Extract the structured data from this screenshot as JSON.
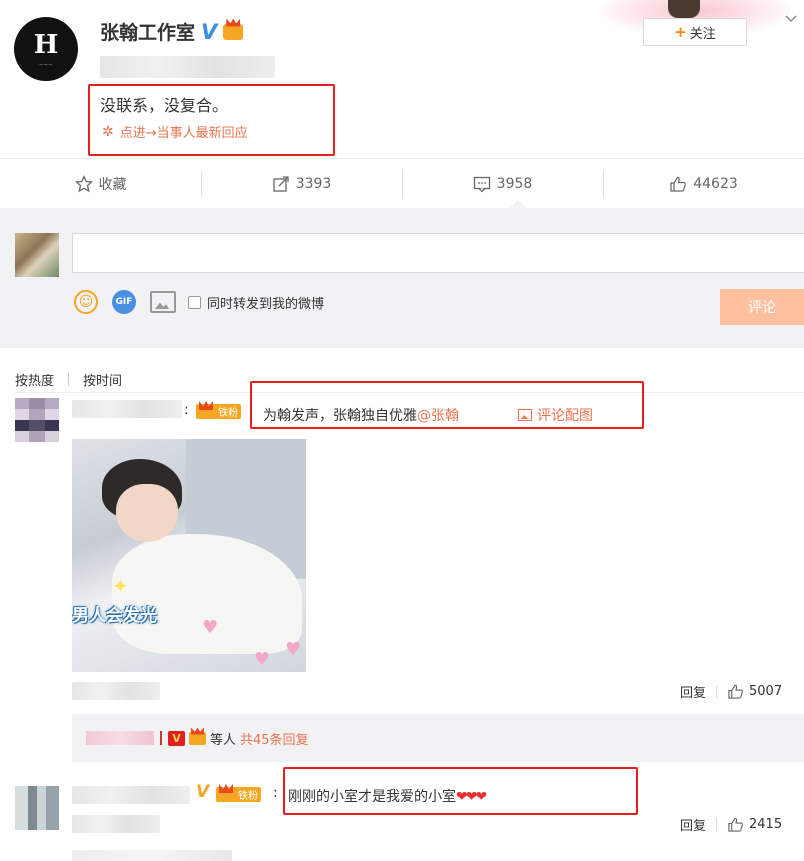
{
  "post": {
    "author": "张翰工作室",
    "text": "没联系，没复合。",
    "link_text": "点进→当事人最新回应",
    "follow_label": "关注"
  },
  "actions": {
    "favorite_label": "收藏",
    "repost_count": "3393",
    "comment_count": "3958",
    "like_count": "44623"
  },
  "composer": {
    "input_value": "",
    "gif_label": "GIF",
    "repost_checkbox_label": "同时转发到我的微博",
    "submit_label": "评论"
  },
  "sort": {
    "by_hot": "按热度",
    "by_time": "按时间"
  },
  "comments": [
    {
      "badge": "铁粉",
      "text": "为翰发声，张翰独自优雅",
      "mention": "@张翰",
      "attachment_label": "评论配图",
      "photo_caption": "男人会发光",
      "reply_label": "回复",
      "like_count": "5007",
      "replies_suffix": "等人",
      "replies_more": "共45条回复"
    },
    {
      "badge": "铁粉",
      "text": "刚刚的小室才是我爱的小室",
      "emoji": "❤❤❤",
      "reply_label": "回复",
      "like_count": "2415"
    }
  ],
  "colors": {
    "accent": "#eb7350",
    "highlight_box": "#e61e1e",
    "follow_plus": "#ff8200",
    "submit_disabled": "#ffc09f",
    "verified": "#3a8ee6"
  }
}
